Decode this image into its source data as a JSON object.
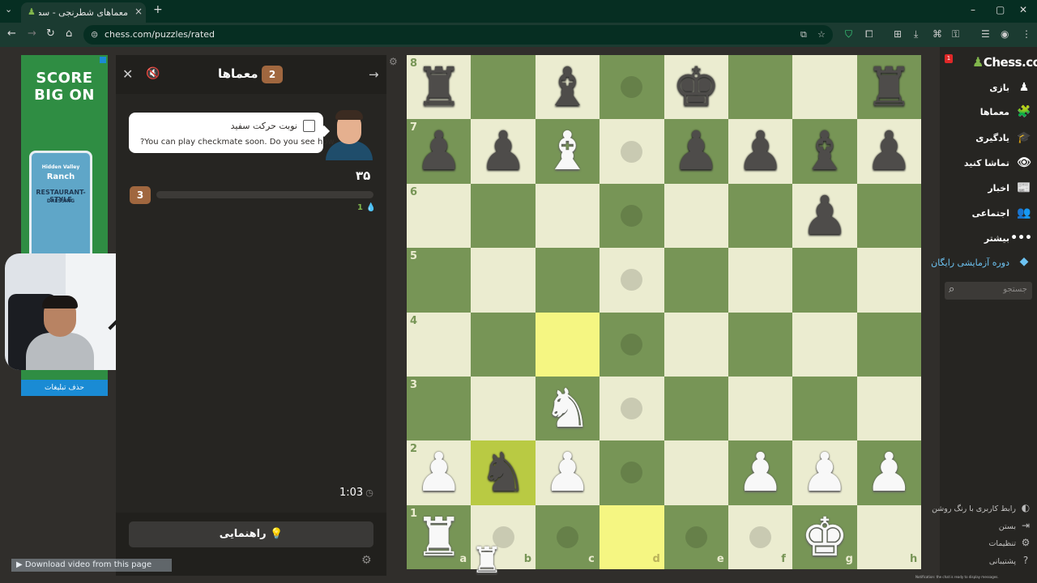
{
  "browser": {
    "tab_title": "معماهای شطرنجی - سطح بازی ...",
    "tab_close": "×",
    "new_tab": "+",
    "url": "chess.com/puzzles/rated",
    "window_min": "–",
    "window_max": "▢",
    "window_close": "✕"
  },
  "ad": {
    "headline1": "SCORE",
    "headline2": "BIG ON",
    "product_brand": "Hidden Valley",
    "product_name": "Ranch",
    "product_sub": "RESTAURANT-STYLE",
    "product_desc": "DRESSING",
    "remove_ads": "حذف تبلیغات"
  },
  "puzzle_panel": {
    "title": "معماها",
    "title_badge": "2",
    "coach_line1": "نوبت حرکت سفید",
    "coach_line2": "?You can play checkmate soon. Do you see how",
    "score": "۳۵",
    "streak_badge": "3",
    "streak_progress": 0,
    "streak_count": "1",
    "timer": "1:03",
    "hint_label": "راهنمایی"
  },
  "download_bar": {
    "label": "Download video from this page"
  },
  "board": {
    "ranks": [
      "8",
      "7",
      "6",
      "5",
      "4",
      "3",
      "2",
      "1"
    ],
    "files": [
      "a",
      "b",
      "c",
      "d",
      "e",
      "f",
      "g",
      "h"
    ],
    "highlights": [
      "c4",
      "d1",
      "b2"
    ],
    "move_dots": [
      "d8",
      "d7",
      "d6",
      "d5",
      "d4",
      "d3",
      "d2",
      "b1",
      "c1",
      "e1",
      "f1"
    ],
    "pieces": [
      {
        "sq": "a8",
        "p": "♜",
        "c": "b"
      },
      {
        "sq": "c8",
        "p": "♝",
        "c": "b"
      },
      {
        "sq": "e8",
        "p": "♚",
        "c": "b"
      },
      {
        "sq": "h8",
        "p": "♜",
        "c": "b"
      },
      {
        "sq": "a7",
        "p": "♟",
        "c": "b"
      },
      {
        "sq": "b7",
        "p": "♟",
        "c": "b"
      },
      {
        "sq": "c7",
        "p": "♝",
        "c": "w"
      },
      {
        "sq": "e7",
        "p": "♟",
        "c": "b"
      },
      {
        "sq": "f7",
        "p": "♟",
        "c": "b"
      },
      {
        "sq": "g7",
        "p": "♝",
        "c": "b"
      },
      {
        "sq": "h7",
        "p": "♟",
        "c": "b"
      },
      {
        "sq": "g6",
        "p": "♟",
        "c": "b"
      },
      {
        "sq": "c3",
        "p": "♞",
        "c": "w"
      },
      {
        "sq": "a2",
        "p": "♟",
        "c": "w"
      },
      {
        "sq": "b2",
        "p": "♞",
        "c": "b"
      },
      {
        "sq": "c2",
        "p": "♟",
        "c": "w"
      },
      {
        "sq": "f2",
        "p": "♟",
        "c": "w"
      },
      {
        "sq": "g2",
        "p": "♟",
        "c": "w"
      },
      {
        "sq": "h2",
        "p": "♟",
        "c": "w"
      },
      {
        "sq": "a1",
        "p": "♜",
        "c": "w"
      },
      {
        "sq": "g1",
        "p": "♚",
        "c": "w"
      }
    ],
    "dragged_piece": "♜"
  },
  "sidebar": {
    "logo": "Chess.com",
    "notification_count": "1",
    "items": [
      {
        "label": "بازی",
        "icon": "♟"
      },
      {
        "label": "معماها",
        "icon": "🧩"
      },
      {
        "label": "یادگیری",
        "icon": "🎓"
      },
      {
        "label": "تماشا کنید",
        "icon": "👁"
      },
      {
        "label": "اخبار",
        "icon": "📰"
      },
      {
        "label": "اجتماعی",
        "icon": "👥"
      },
      {
        "label": "بیشتر",
        "icon": "•••"
      }
    ],
    "trial_label": "دوره آزمایشی رایگان",
    "search_placeholder": "جستجو",
    "footer": [
      {
        "label": "رابط کاربری با رنگ روشن",
        "icon": "◐"
      },
      {
        "label": "بستن",
        "icon": "⇥"
      },
      {
        "label": "تنظیمات",
        "icon": "⚙"
      },
      {
        "label": "پشتیبانی",
        "icon": "?"
      }
    ],
    "tiny_note": "Notification: the chat is ready to display messages."
  },
  "colors": {
    "light_square": "#ebecd0",
    "dark_square": "#779556",
    "highlight_light": "#f5f682",
    "highlight_dark": "#b9ca43",
    "accent_green": "#81b64c",
    "panel_bg": "#262522"
  }
}
